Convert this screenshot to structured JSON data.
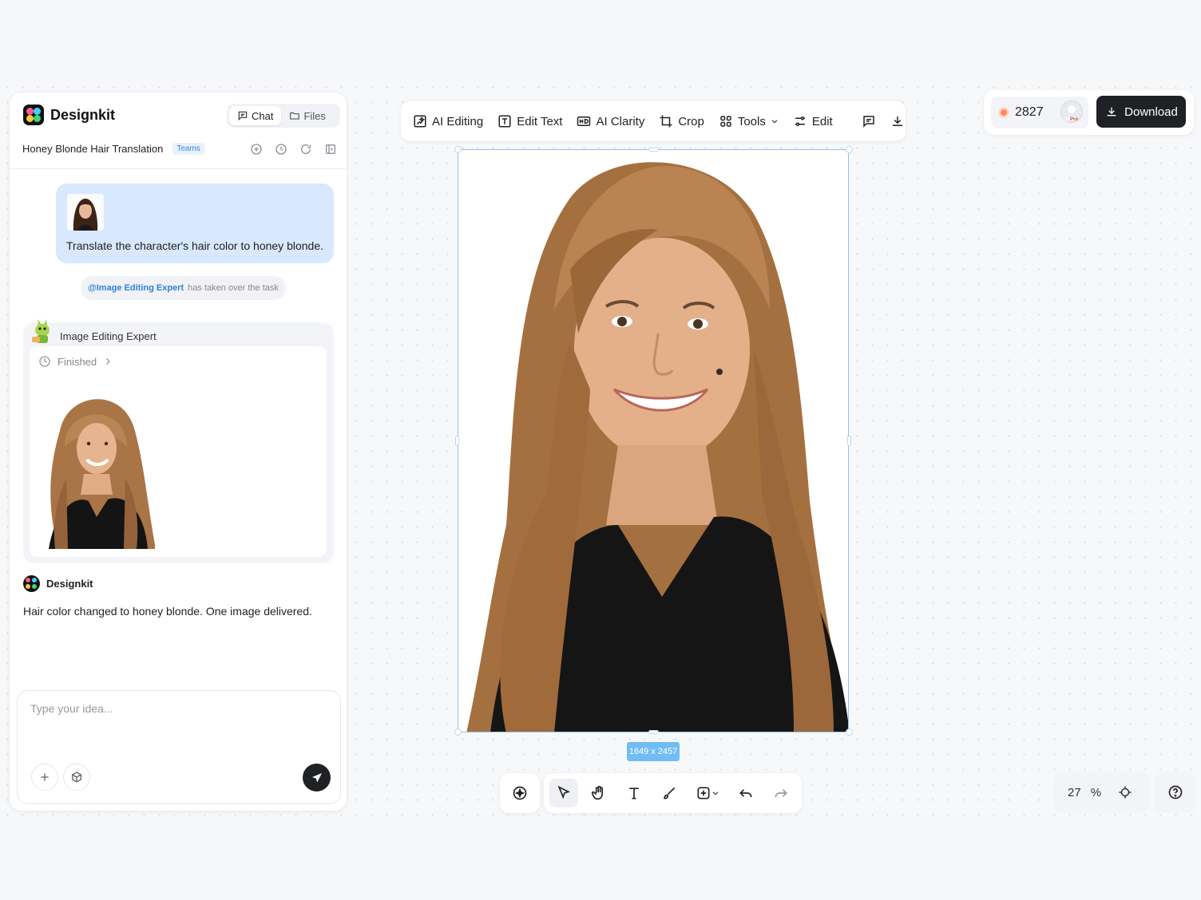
{
  "app": {
    "brand": "Designkit"
  },
  "panel": {
    "tabs": [
      {
        "label": "Chat",
        "icon": "chat-icon",
        "active": true
      },
      {
        "label": "Files",
        "icon": "folder-icon",
        "active": false
      }
    ],
    "conversation_title": "Honey Blonde Hair Translation",
    "badge": "Teams",
    "title_icons": [
      "new-chat-icon",
      "history-icon",
      "refresh-icon",
      "collapse-panel-icon"
    ],
    "user_message": "Translate the character's hair color to honey blonde.",
    "notice": {
      "mention": "@Image Editing Expert",
      "text": "has taken over the task"
    },
    "agent": {
      "name": "Image Editing Expert",
      "status": "Finished"
    },
    "bot": {
      "name": "Designkit",
      "message": "Hair color changed to honey blonde. One image delivered."
    },
    "input": {
      "placeholder": "Type your idea..."
    }
  },
  "toolbar": {
    "items": [
      {
        "label": "AI Editing",
        "icon": "ai-edit-icon"
      },
      {
        "label": "Edit Text",
        "icon": "text-box-icon"
      },
      {
        "label": "AI Clarity",
        "icon": "hd-icon"
      },
      {
        "label": "Crop",
        "icon": "crop-icon"
      },
      {
        "label": "Tools",
        "icon": "grid-icon"
      },
      {
        "label": "Edit",
        "icon": "sliders-icon"
      }
    ]
  },
  "account": {
    "credits": "2827",
    "pro_label": "Pro",
    "download_label": "Download"
  },
  "canvas": {
    "image_size": "1649 x 2457"
  },
  "zoom": {
    "value": "27",
    "unit": "%"
  },
  "colors": {
    "accent": "#8ec2f5",
    "dark_button": "#1f2125",
    "bubble": "#d8e8ff",
    "badge": "#70bdf5"
  }
}
